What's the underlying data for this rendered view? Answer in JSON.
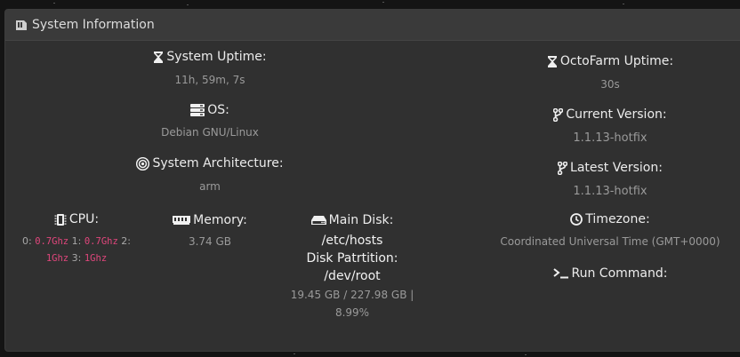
{
  "header": {
    "title": "System Information",
    "icon": "hdd-icon"
  },
  "uptime": {
    "label": "System Uptime:",
    "value": "11h, 59m, 7s"
  },
  "os": {
    "label": "OS:",
    "value": "Debian GNU/Linux"
  },
  "arch": {
    "label": "System Architecture:",
    "value": "arm"
  },
  "cpu": {
    "label": "CPU:",
    "cores": [
      {
        "index": "0:",
        "speed": "0.7Ghz"
      },
      {
        "index": "1:",
        "speed": "0.7Ghz"
      },
      {
        "index": "2:",
        "speed": "1Ghz"
      },
      {
        "index": "3:",
        "speed": "1Ghz"
      }
    ]
  },
  "memory": {
    "label": "Memory:",
    "value": "3.74 GB"
  },
  "disk": {
    "label": "Main Disk:",
    "path": "/etc/hosts",
    "partition_label": "Disk Patrtition:",
    "partition": "/dev/root",
    "usage": "19.45 GB / 227.98 GB |",
    "percent": "8.99%"
  },
  "octofarm_uptime": {
    "label": "OctoFarm Uptime:",
    "value": "30s"
  },
  "current_version": {
    "label": "Current Version:",
    "value": "1.1.13-hotfix"
  },
  "latest_version": {
    "label": "Latest Version:",
    "value": "1.1.13-hotfix"
  },
  "timezone": {
    "label": "Timezone:",
    "value": "Coordinated Universal Time (GMT+0000)"
  },
  "run_command": {
    "label": "Run Command:"
  },
  "colors": {
    "accent_code": "#e0467c",
    "card_bg": "#303030",
    "header_bg": "#3a3a3a"
  }
}
